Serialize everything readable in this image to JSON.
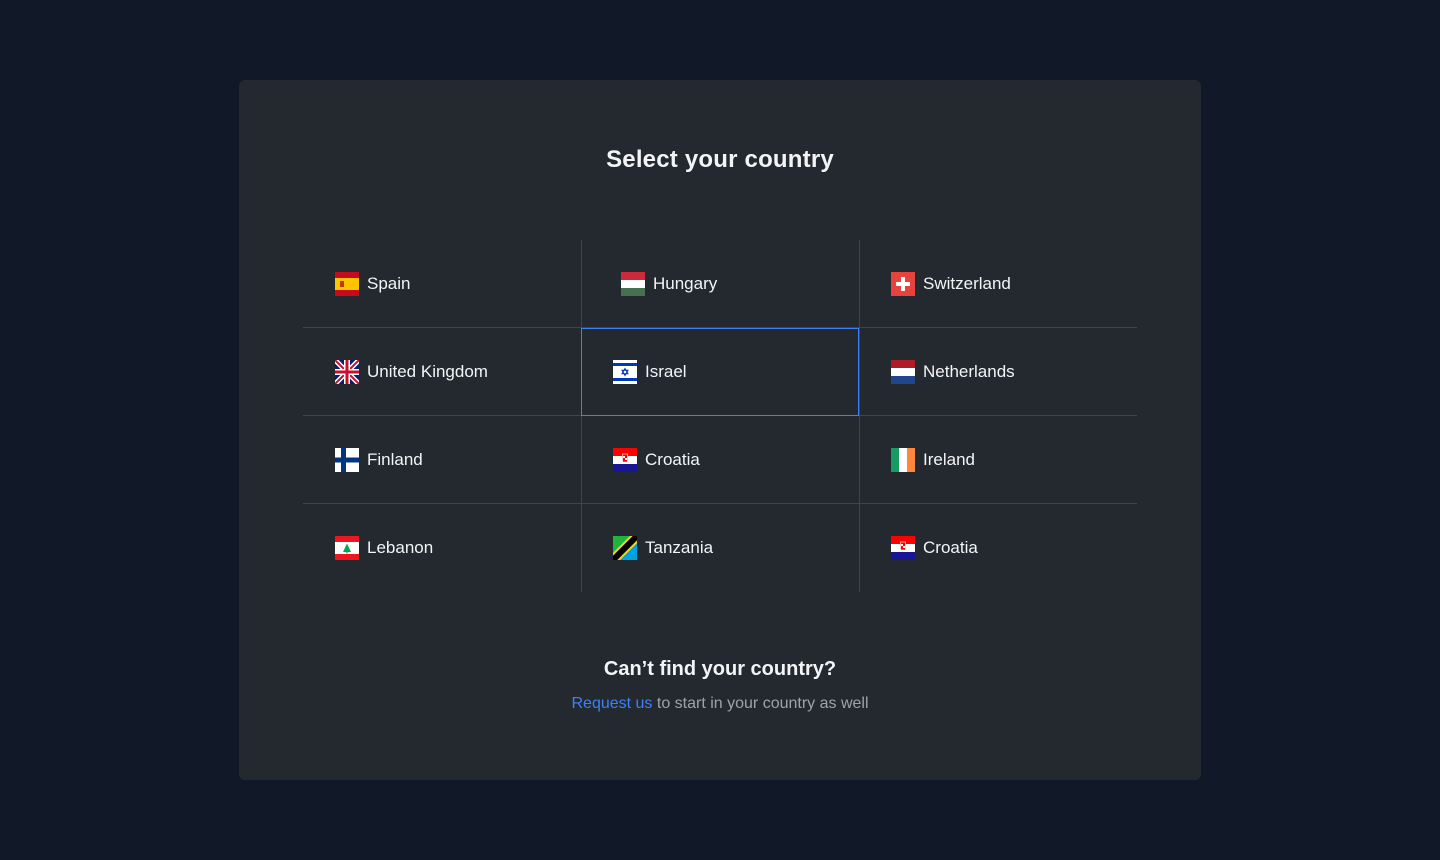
{
  "title": "Select your country",
  "countries": [
    {
      "name": "Spain",
      "flag": "spain-flag"
    },
    {
      "name": "Hungary",
      "flag": "hungary-flag"
    },
    {
      "name": "Switzerland",
      "flag": "switzerland-flag"
    },
    {
      "name": "United Kingdom",
      "flag": "uk-flag"
    },
    {
      "name": "Israel",
      "flag": "israel-flag"
    },
    {
      "name": "Netherlands",
      "flag": "netherlands-flag"
    },
    {
      "name": "Finland",
      "flag": "finland-flag"
    },
    {
      "name": "Croatia",
      "flag": "croatia-flag"
    },
    {
      "name": "Ireland",
      "flag": "ireland-flag"
    },
    {
      "name": "Lebanon",
      "flag": "lebanon-flag"
    },
    {
      "name": "Tanzania",
      "flag": "tanzania-flag"
    },
    {
      "name": "Croatia",
      "flag": "croatia-flag"
    }
  ],
  "selected_index": 4,
  "footer": {
    "title": "Can’t find your country?",
    "link_label": "Request us",
    "rest_text": " to start in your country as well"
  },
  "colors": {
    "background": "#111827",
    "card": "#24292f",
    "accent": "#3b82f6",
    "divider": "#3f454d"
  }
}
